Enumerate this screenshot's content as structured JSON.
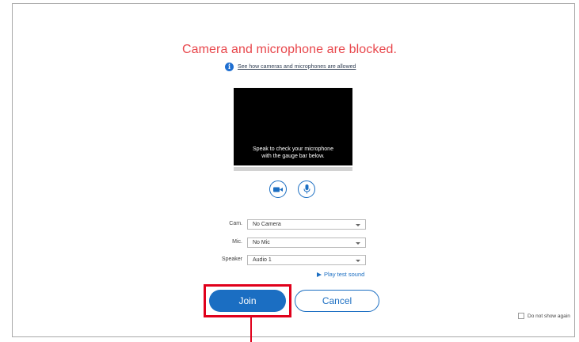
{
  "dialog": {
    "title": "Camera and microphone are blocked.",
    "help_link": "See how cameras and microphones are allowed",
    "preview_text_line1": "Speak to check your microphone",
    "preview_text_line2": "with the gauge bar below."
  },
  "devices": {
    "camera": {
      "label": "Cam.",
      "value": "No Camera"
    },
    "microphone": {
      "label": "Mic.",
      "value": "No Mic"
    },
    "speaker": {
      "label": "Speaker",
      "value": "Audio 1"
    }
  },
  "play_test_sound": "Play test sound",
  "buttons": {
    "join": "Join",
    "cancel": "Cancel"
  },
  "do_not_show_again": {
    "label": "Do not show again",
    "checked": false
  },
  "colors": {
    "accent": "#1b6ec2",
    "warning": "#e8474c",
    "highlight": "#e0001b"
  }
}
